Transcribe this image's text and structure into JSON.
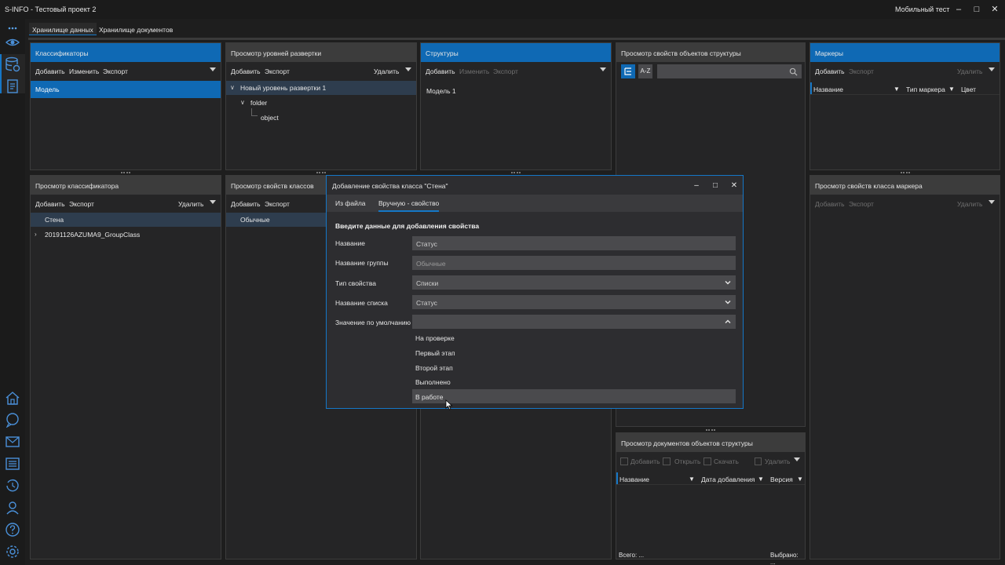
{
  "titlebar": {
    "title": "S-INFO - Тестовый проект 2",
    "user": "Мобильный тест"
  },
  "tabs": [
    "Хранилище данных",
    "Хранилище документов"
  ],
  "classifiers": {
    "title": "Классификаторы",
    "toolbar": [
      "Добавить",
      "Изменить",
      "Экспорт"
    ],
    "items": [
      "Модель"
    ]
  },
  "levels": {
    "title": "Просмотр уровней развертки",
    "toolbar": [
      "Добавить",
      "Экспорт"
    ],
    "delete": "Удалить",
    "tree": [
      "Новый уровень развертки 1",
      "folder",
      "object"
    ]
  },
  "structures": {
    "title": "Структуры",
    "toolbar": [
      "Добавить",
      "Изменить",
      "Экспорт"
    ],
    "items": [
      "Модель 1"
    ]
  },
  "props_objects": {
    "title": "Просмотр свойств объектов структуры",
    "az": "A-Z"
  },
  "markers": {
    "title": "Маркеры",
    "toolbar": [
      "Добавить",
      "Экспорт"
    ],
    "delete": "Удалить",
    "columns": [
      "Название",
      "Тип маркера",
      "Цвет"
    ]
  },
  "classifier_view": {
    "title": "Просмотр классификатора",
    "toolbar": [
      "Добавить",
      "Экспорт"
    ],
    "delete": "Удалить",
    "items": [
      "Стена",
      "20191126AZUMA9_GroupClass"
    ]
  },
  "class_props": {
    "title": "Просмотр свойств классов",
    "toolbar": [
      "Добавить",
      "Экспорт"
    ],
    "items": [
      "Обычные"
    ]
  },
  "marker_class_props": {
    "title": "Просмотр свойств класса маркера",
    "toolbar": [
      "Добавить",
      "Экспорт"
    ],
    "delete": "Удалить"
  },
  "docs": {
    "title": "Просмотр документов объектов структуры",
    "toolbar": [
      "Добавить",
      "Открыть",
      "Скачать"
    ],
    "delete": "Удалить",
    "columns": [
      "Название",
      "Дата добавления",
      "Версия"
    ],
    "total": "Всего: ...",
    "selected": "Выбрано: ..."
  },
  "dialog": {
    "title": "Добавление свойства класса \"Стена\"",
    "tabs": [
      "Из файла",
      "Вручную - свойство"
    ],
    "heading": "Введите данные для добавления свойства",
    "labels": [
      "Название",
      "Название группы",
      "Тип свойства",
      "Название списка",
      "Значение по умолчанию"
    ],
    "values": {
      "name": "Статус",
      "group": "Обычные",
      "type": "Списки",
      "list": "Статус",
      "default": ""
    },
    "options": [
      "На проверке",
      "Первый этап",
      "Второй этап",
      "Выполнено",
      "В работе"
    ]
  }
}
